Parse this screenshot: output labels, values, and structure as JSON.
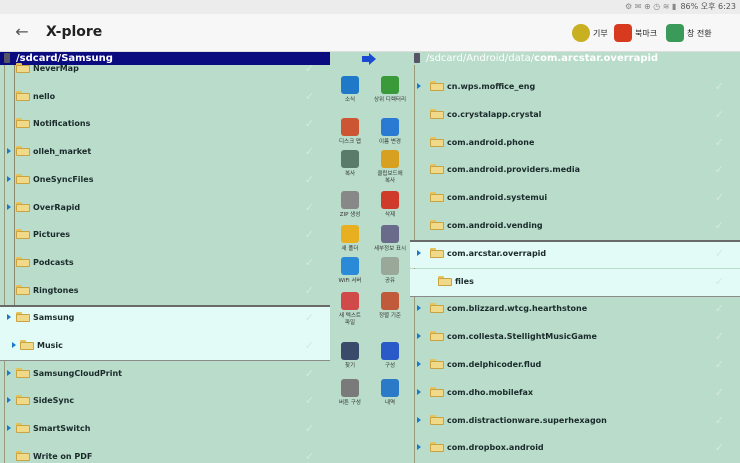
{
  "status": {
    "right_text": "86% 오후 6:23"
  },
  "appbar": {
    "title": "X-plore",
    "buttons": [
      {
        "label": "기부",
        "icon": "coin-icon"
      },
      {
        "label": "북마크",
        "icon": "bookmark-icon"
      },
      {
        "label": "창 전환",
        "icon": "window-switch-icon"
      }
    ]
  },
  "left": {
    "path_prefix": "/sdcard/",
    "path_bold": "Samsung",
    "items": [
      {
        "name": "NeverMap"
      },
      {
        "name": "nello"
      },
      {
        "name": "Notifications"
      },
      {
        "name": "olleh_market"
      },
      {
        "name": "OneSyncFiles"
      },
      {
        "name": "OverRapid"
      },
      {
        "name": "Pictures"
      },
      {
        "name": "Podcasts"
      },
      {
        "name": "Ringtones"
      },
      {
        "name": "Samsung"
      },
      {
        "name": "Music"
      },
      {
        "name": "SamsungCloudPrint"
      },
      {
        "name": "SideSync"
      },
      {
        "name": "SmartSwitch"
      },
      {
        "name": "Write on PDF"
      }
    ]
  },
  "right": {
    "path_prefix": "/sdcard/Android/data/",
    "path_bold": "com.arcstar.overrapid",
    "items": [
      {
        "name": "cn.wps.moffice_eng"
      },
      {
        "name": "co.crystalapp.crystal"
      },
      {
        "name": "com.android.phone"
      },
      {
        "name": "com.android.providers.media"
      },
      {
        "name": "com.android.systemui"
      },
      {
        "name": "com.android.vending"
      },
      {
        "name": "com.arcstar.overrapid"
      },
      {
        "name": "files"
      },
      {
        "name": "com.blizzard.wtcg.hearthstone"
      },
      {
        "name": "com.collesta.StellightMusicGame"
      },
      {
        "name": "com.delphicoder.flud"
      },
      {
        "name": "com.dho.mobilefax"
      },
      {
        "name": "com.distractionware.superhexagon"
      },
      {
        "name": "com.dropbox.android"
      }
    ]
  },
  "tools": [
    {
      "label": "소식",
      "icon": "info-icon",
      "color": "#1f78c8"
    },
    {
      "label": "상위 디렉터리",
      "icon": "up-arrow-icon",
      "color": "#3a9a3a"
    },
    {
      "label": "디스크 맵",
      "icon": "disk-map-icon",
      "color": "#cc5533"
    },
    {
      "label": "이름 변경",
      "icon": "rename-icon",
      "color": "#2a7ad4"
    },
    {
      "label": "복사",
      "icon": "copy-icon",
      "color": "#5a7a6a"
    },
    {
      "label": "클립보드에\n복사",
      "icon": "clipboard-icon",
      "color": "#d8a020"
    },
    {
      "label": "ZIP 생성",
      "icon": "zip-icon",
      "color": "#888888"
    },
    {
      "label": "삭제",
      "icon": "delete-icon",
      "color": "#d03a2a"
    },
    {
      "label": "새 폴더",
      "icon": "new-folder-icon",
      "color": "#e8b020"
    },
    {
      "label": "세부정보 표시",
      "icon": "details-icon",
      "color": "#6a6a8a"
    },
    {
      "label": "WiFi 서버",
      "icon": "wifi-icon",
      "color": "#2a8ad8"
    },
    {
      "label": "공유",
      "icon": "share-icon",
      "color": "#9aa89a"
    },
    {
      "label": "새 텍스트\n파일",
      "icon": "new-text-file-icon",
      "color": "#d04a4a"
    },
    {
      "label": "정렬 기준",
      "icon": "sort-icon",
      "color": "#c05a3a"
    },
    {
      "label": "찾기",
      "icon": "search-icon",
      "color": "#3a4a6a"
    },
    {
      "label": "구성",
      "icon": "settings-icon",
      "color": "#2a5ac8"
    },
    {
      "label": "버튼 구성",
      "icon": "button-config-icon",
      "color": "#7a7a7a"
    },
    {
      "label": "내역",
      "icon": "history-icon",
      "color": "#2a7ac8"
    }
  ]
}
